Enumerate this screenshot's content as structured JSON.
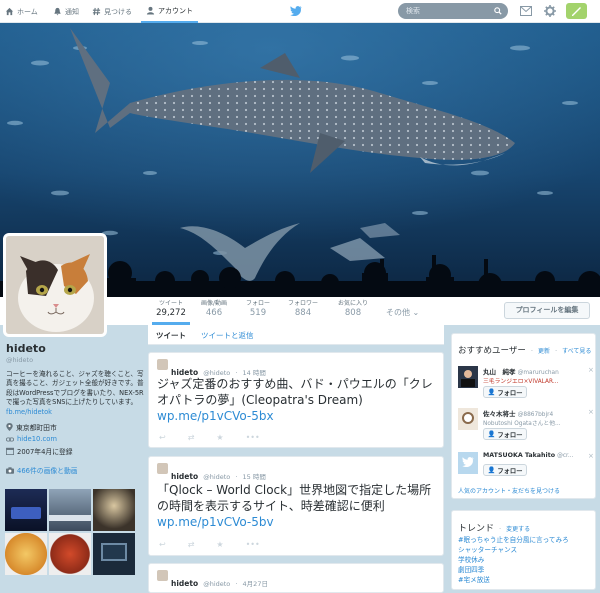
{
  "nav": {
    "home": "ホーム",
    "notifications": "通知",
    "discover": "見つける",
    "account": "アカウント",
    "search_placeholder": "検索"
  },
  "stats": {
    "tweets_label": "ツイート",
    "tweets_value": "29,272",
    "media_label": "画像/動画",
    "media_value": "466",
    "following_label": "フォロー",
    "following_value": "519",
    "followers_label": "フォロワー",
    "followers_value": "884",
    "favorites_label": "お気に入り",
    "favorites_value": "808",
    "more_label": "その他"
  },
  "edit_profile_label": "プロフィールを編集",
  "profile": {
    "name": "hideto",
    "handle": "@hideto",
    "bio": "コーヒーを淹れること、ジャズを聴くこと、写真を撮ること、ガジェット全般が好きです。普段はWordPressでブログを書いたり、NEX-5Rで撮った写真をSNSに上げたりしています。",
    "bio_link": "fb.me/hidetok",
    "location": "東京都町田市",
    "website": "hide10.com",
    "joined": "2007年4月に登録",
    "media_count_label": "466件の画像と動画"
  },
  "tabs": {
    "tweets": "ツイート",
    "tweets_replies": "ツイートと返信"
  },
  "tweets": [
    {
      "name": "hideto",
      "handle": "@hideto",
      "time": "14 時間",
      "text": "ジャズ定番のおすすめ曲、バド・パウエルの「クレオパトラの夢」(Cleopatra's Dream) ",
      "link": "wp.me/p1vCVo-5bx"
    },
    {
      "name": "hideto",
      "handle": "@hideto",
      "time": "15 時間",
      "text": "「Qlock – World Clock」世界地図で指定した場所の時間を表示するサイト、時差確認に便利 ",
      "link": "wp.me/p1vCVo-5bv"
    },
    {
      "name": "hideto",
      "handle": "@hideto",
      "time": "4月27日"
    }
  ],
  "who_to_follow": {
    "title": "おすすめユーザー",
    "refresh": "更新",
    "view_all": "すべて見る",
    "follow_label": "フォロー",
    "users": [
      {
        "name": "丸山　純孝",
        "handle": "@maruruchan",
        "sub": "三毛ランジエロ×VIVALAR..."
      },
      {
        "name": "佐々木将士",
        "handle": "@8867bbjr4",
        "sub": "Nobutoshi Ogataさんと他..."
      },
      {
        "name": "MATSUOKA Takahito",
        "handle": "@cr...",
        "sub": ""
      }
    ],
    "footer": "人気のアカウント・友だちを見つける"
  },
  "trends": {
    "title": "トレンド",
    "change": "変更する",
    "items": [
      "#眠っちゃう止を自分風に言ってみろ",
      "シャッターチャンス",
      "学校休み",
      "劇団四季",
      "#宅メ放送"
    ]
  },
  "colors": {
    "accent": "#55acee",
    "link": "#2d8bd4",
    "background": "#c7dbe6",
    "follow_button_blue": "#1b95e0"
  }
}
